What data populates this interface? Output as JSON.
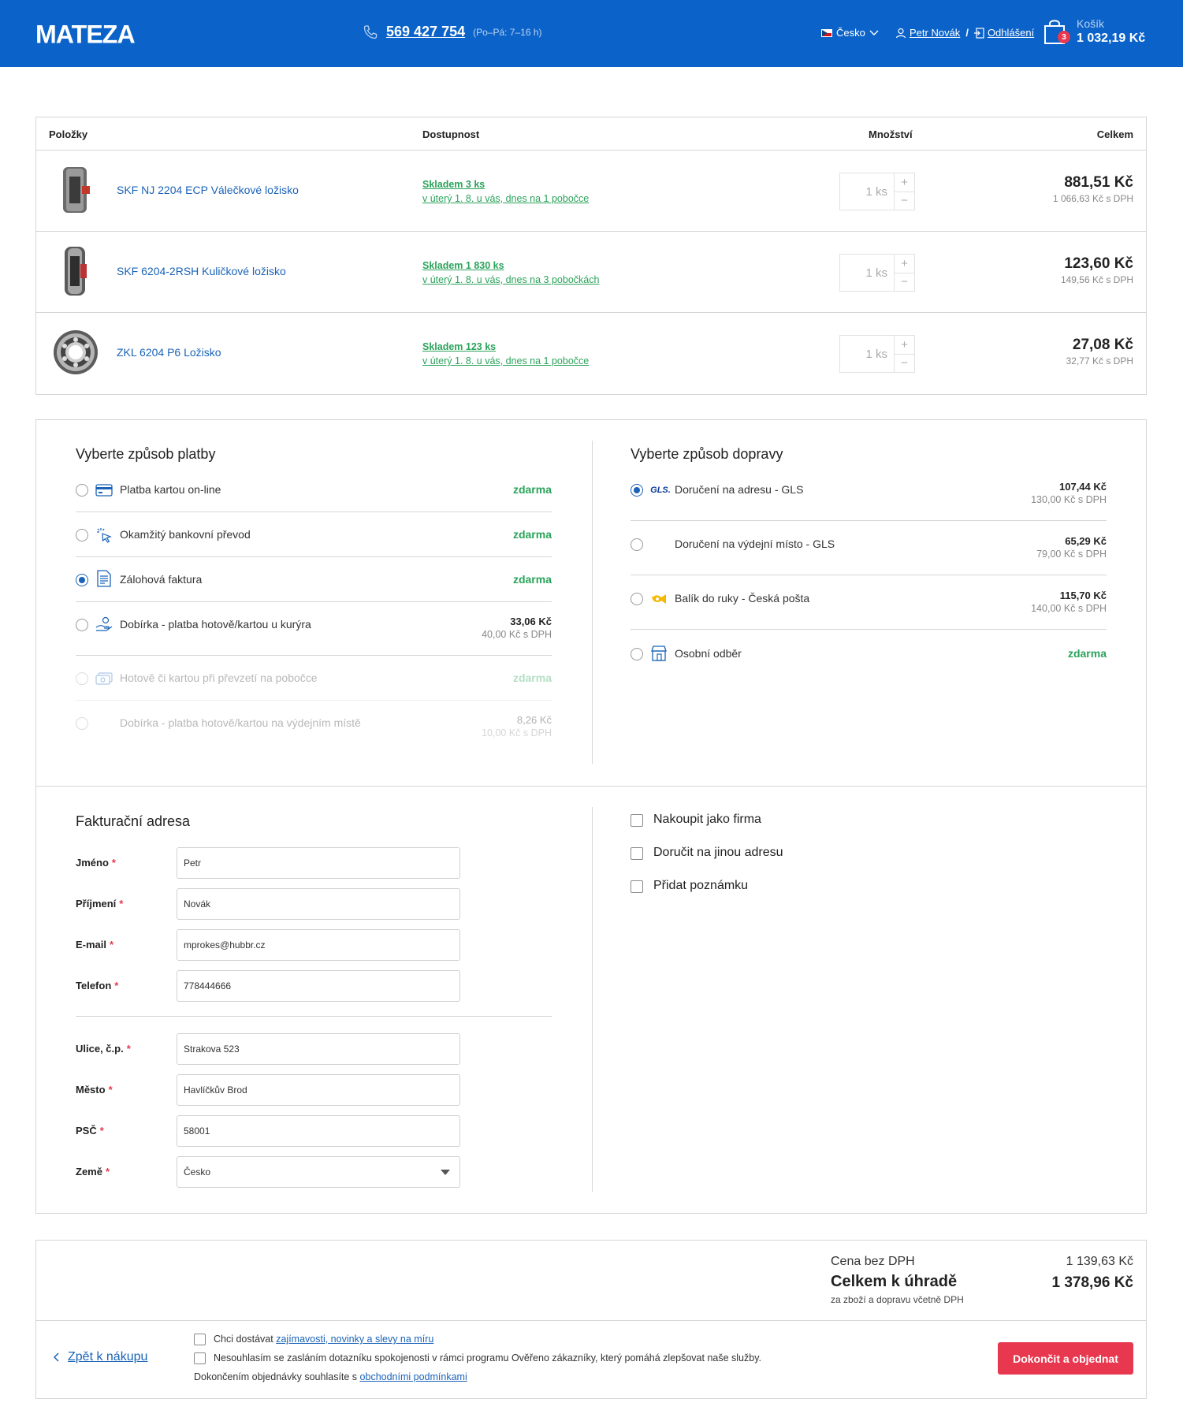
{
  "header": {
    "logo": "MATEZA",
    "phone": "569 427 754",
    "phone_hours": "(Po–Pá: 7–16 h)",
    "language": "Česko",
    "user_name": "Petr Novák",
    "user_sep": "/",
    "logout": "Odhlášení",
    "cart_label": "Košík",
    "cart_count": "3",
    "cart_total": "1 032,19 Kč"
  },
  "items": {
    "columns": {
      "items": "Položky",
      "availability": "Dostupnost",
      "quantity": "Množství",
      "total": "Celkem"
    },
    "rows": [
      {
        "name": "SKF NJ 2204 ECP Válečkové ložisko",
        "stock": "Skladem 3 ks",
        "delivery": "v úterý 1. 8. u vás, dnes na 1 pobočce",
        "qty": "1 ks",
        "price": "881,51 Kč",
        "price_vat": "1 066,63 Kč s DPH",
        "image": "cylindrical-bearing"
      },
      {
        "name": "SKF 6204-2RSH Kuličkové ložisko",
        "stock": "Skladem 1 830 ks",
        "delivery": "v úterý 1. 8. u vás, dnes na 3 pobočkách",
        "qty": "1 ks",
        "price": "123,60 Kč",
        "price_vat": "149,56 Kč s DPH",
        "image": "ball-bearing-side"
      },
      {
        "name": "ZKL 6204 P6 Ložisko",
        "stock": "Skladem 123 ks",
        "delivery": "v úterý 1. 8. u vás, dnes na 1 pobočce",
        "qty": "1 ks",
        "price": "27,08 Kč",
        "price_vat": "32,77 Kč s DPH",
        "image": "ball-bearing-front"
      }
    ],
    "plus": "+",
    "minus": "−"
  },
  "payment": {
    "title": "Vyberte způsob platby",
    "options": [
      {
        "label": "Platba kartou on-line",
        "free": "zdarma",
        "icon": "card-icon",
        "checked": false
      },
      {
        "label": "Okamžitý bankovní převod",
        "free": "zdarma",
        "icon": "click-icon",
        "checked": false
      },
      {
        "label": "Zálohová faktura",
        "free": "zdarma",
        "icon": "invoice-icon",
        "checked": true
      },
      {
        "label": "Dobírka - platba hotově/kartou u kurýra",
        "price": "33,06 Kč",
        "price_vat": "40,00 Kč s DPH",
        "icon": "courier-icon",
        "checked": false
      },
      {
        "label": "Hotově či kartou při převzetí na pobočce",
        "free": "zdarma",
        "icon": "cash-icon",
        "checked": false,
        "disabled": true
      },
      {
        "label": "Dobírka - platba hotově/kartou na výdejním místě",
        "price": "8,26 Kč",
        "price_vat": "10,00 Kč s DPH",
        "checked": false,
        "disabled": true
      }
    ]
  },
  "shipping": {
    "title": "Vyberte způsob dopravy",
    "options": [
      {
        "label": "Doručení na adresu - GLS",
        "price": "107,44 Kč",
        "price_vat": "130,00 Kč s DPH",
        "icon": "gls-logo-icon",
        "icon_text": "GLS.",
        "checked": true
      },
      {
        "label": "Doručení na výdejní místo - GLS",
        "price": "65,29 Kč",
        "price_vat": "79,00 Kč s DPH",
        "checked": false
      },
      {
        "label": "Balík do ruky - Česká pošta",
        "price": "115,70 Kč",
        "price_vat": "140,00 Kč s DPH",
        "icon": "czech-post-horn-icon",
        "checked": false
      },
      {
        "label": "Osobní odběr",
        "free": "zdarma",
        "icon": "store-icon",
        "checked": false
      }
    ]
  },
  "billing": {
    "title": "Fakturační adresa",
    "fields": [
      {
        "label": "Jméno",
        "value": "Petr"
      },
      {
        "label": "Příjmení",
        "value": "Novák"
      },
      {
        "label": "E-mail",
        "value": "mprokes@hubbr.cz"
      },
      {
        "label": "Telefon",
        "value": "778444666"
      },
      {
        "label": "Ulice, č.p.",
        "value": "Strakova 523"
      },
      {
        "label": "Město",
        "value": "Havlíčkův Brod"
      },
      {
        "label": "PSČ",
        "value": "58001"
      },
      {
        "label": "Země",
        "value": "Česko"
      }
    ],
    "required_mark": "*",
    "options": [
      "Nakoupit jako firma",
      "Doručit na jinou adresu",
      "Přidat poznámku"
    ]
  },
  "summary": {
    "net_label": "Cena bez DPH",
    "net_value": "1 139,63 Kč",
    "total_label": "Celkem k úhradě",
    "total_value": "1 378,96 Kč",
    "total_note": "za zboží a dopravu včetně DPH",
    "back": "Zpět k nákupu",
    "newsletter_prefix": "Chci dostávat ",
    "newsletter_link": "zajímavosti, novinky a slevy na míru",
    "survey": "Nesouhlasím se zasláním dotazníku spokojenosti v rámci programu Ověřeno zákazníky, který pomáhá zlepšovat naše služby.",
    "terms_prefix": "Dokončením objednávky souhlasíte s ",
    "terms_link": "obchodními podmínkami",
    "submit": "Dokončit a objednat"
  },
  "colors": {
    "brand": "#0b63c9",
    "link": "#1a63b7",
    "green": "#2aa35a",
    "accent": "#e8384f"
  }
}
